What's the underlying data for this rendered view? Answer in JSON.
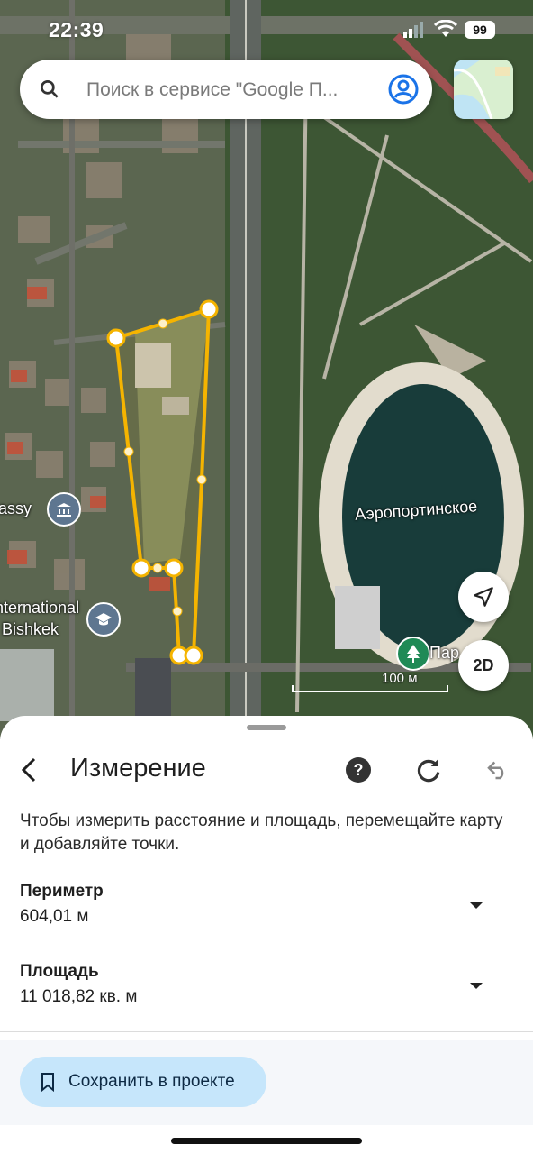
{
  "status": {
    "time": "22:39",
    "battery": "99"
  },
  "search": {
    "placeholder": "Поиск в сервисе \"Google П..."
  },
  "map": {
    "lake_label": "Аэропортинское",
    "labels": {
      "embassy": "assy",
      "international": "nternational",
      "bishkek": "Bishkek",
      "park": "Пар"
    },
    "scale": "100 м",
    "mode_button": "2D",
    "colors": {
      "measure_line": "#f5b400",
      "lake": "#173c3a"
    }
  },
  "sheet": {
    "title": "Измерение",
    "hint": "Чтобы измерить расстояние и площадь, перемещайте карту и добавляйте точки.",
    "perimeter": {
      "label": "Периметр",
      "value": "604,01 м"
    },
    "area": {
      "label": "Площадь",
      "value": "11 018,82 кв. м"
    },
    "save_button": "Сохранить в проекте"
  },
  "icons": [
    "search-icon",
    "account-icon",
    "layers-icon",
    "back-icon",
    "help-icon",
    "reset-icon",
    "undo-icon",
    "navigation-icon",
    "bookmark-icon",
    "chevron-down-icon"
  ]
}
